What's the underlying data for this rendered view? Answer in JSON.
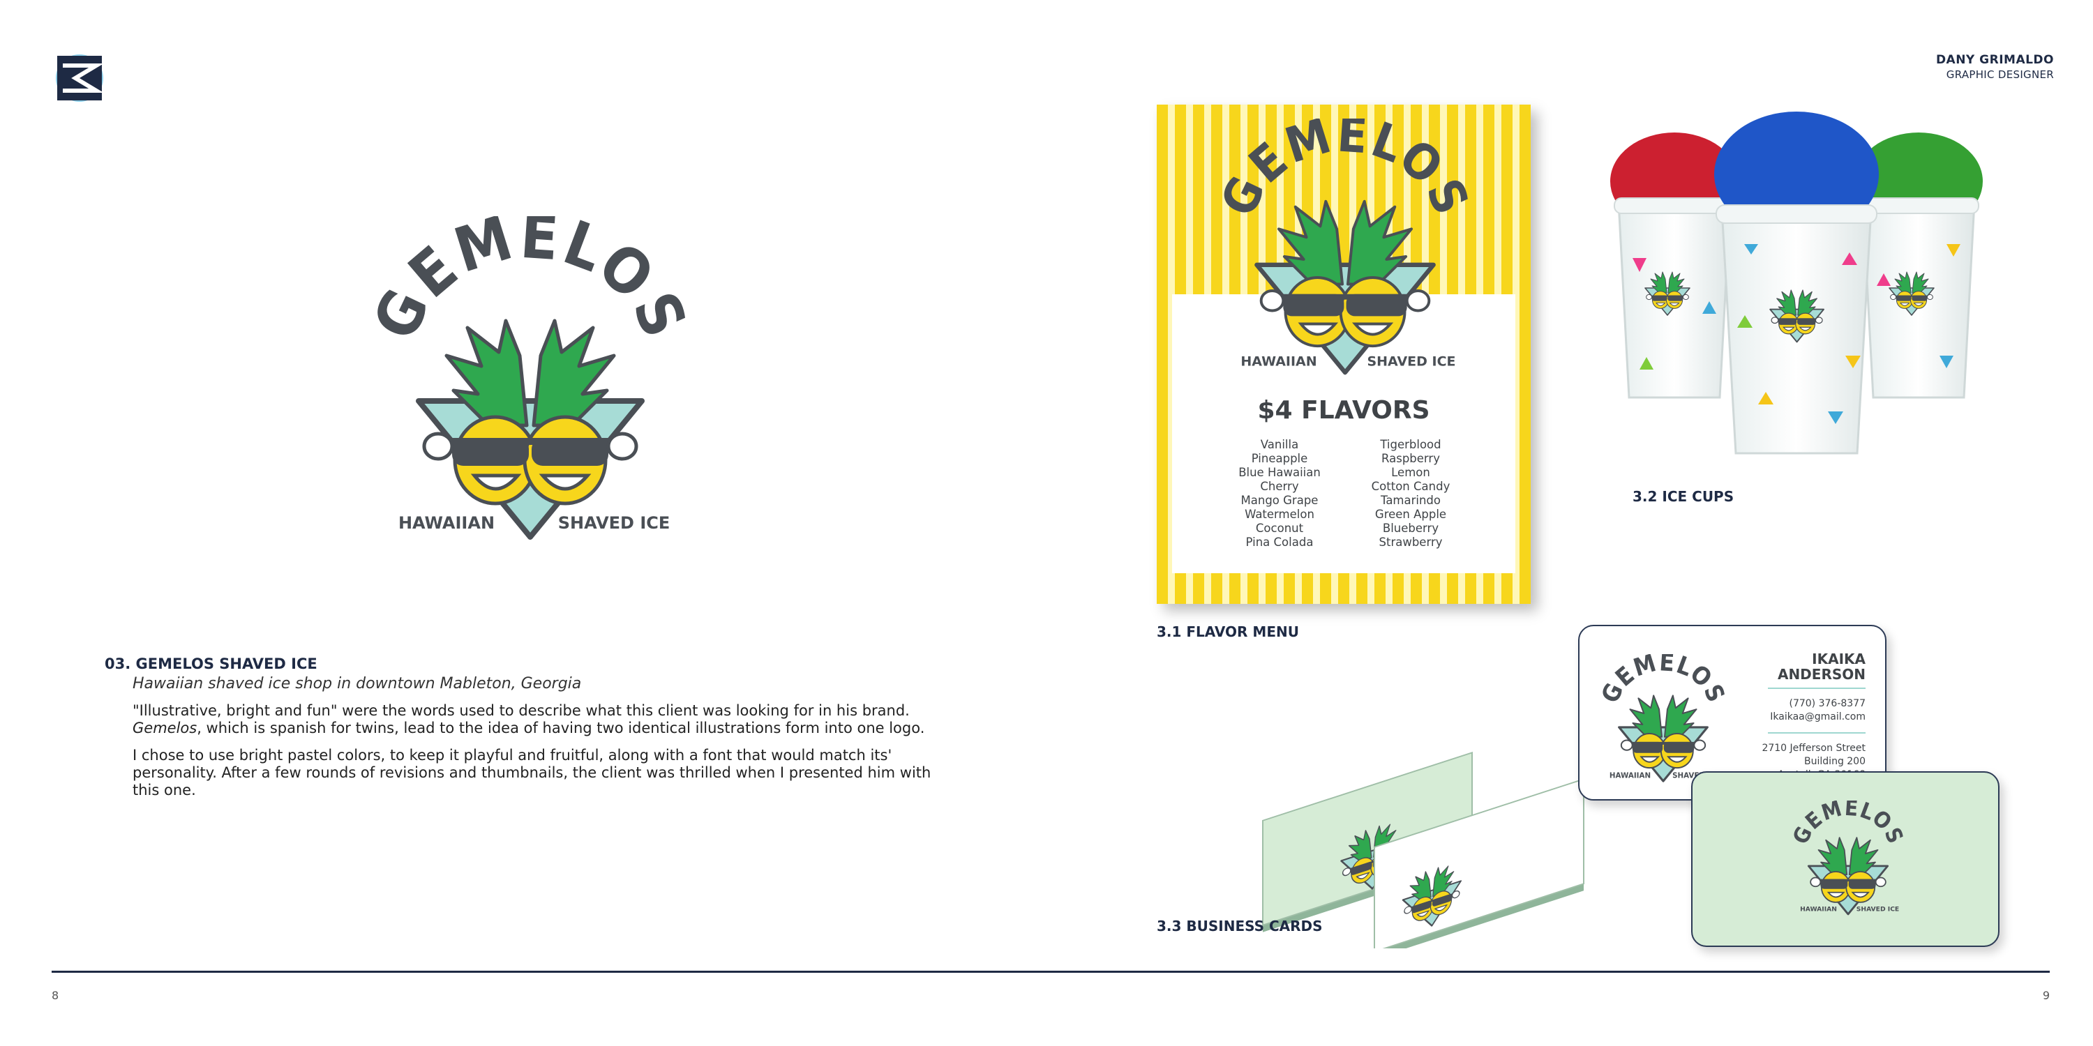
{
  "header": {
    "designer_name": "DANY GRIMALDO",
    "designer_role": "GRAPHIC DESIGNER"
  },
  "logo": {
    "brand": "GEMELOS",
    "left_tag": "HAWAIIAN",
    "right_tag": "SHAVED ICE"
  },
  "project": {
    "title": "03. GEMELOS SHAVED ICE",
    "subtitle": "Hawaiian shaved ice shop in downtown Mableton, Georgia",
    "paragraph1_a": "\"Illustrative, bright and fun\" were the words used to describe what this client was looking for in his brand.",
    "paragraph1_b_em": "Gemelos",
    "paragraph1_b": ", which is spanish for twins, lead to the idea of having two identical illustrations form into one logo.",
    "paragraph2": "I chose to use bright pastel colors, to keep it playful and fruitful, along with a font that would match its' personality. After a few rounds of revisions and thumbnails, the client was thrilled when I presented him with this one."
  },
  "menu": {
    "heading": "$4 FLAVORS",
    "flavors_left": [
      "Vanilla",
      "Pineapple",
      "Blue Hawaiian",
      "Cherry",
      "Mango Grape",
      "Watermelon",
      "Coconut",
      "Pina Colada"
    ],
    "flavors_right": [
      "Tigerblood",
      "Raspberry",
      "Lemon",
      "Cotton Candy",
      "Tamarindo",
      "Green Apple",
      "Blueberry",
      "Strawberry"
    ]
  },
  "captions": {
    "menu": "3.1  FLAVOR MENU",
    "cups": "3.2 ICE CUPS",
    "cards": "3.3 BUSINESS CARDS"
  },
  "business_card": {
    "first_name": "IKAIKA",
    "last_name": "ANDERSON",
    "phone": "(770) 376-8377",
    "email": "Ikaikaa@gmail.com",
    "street": "2710 Jefferson Street",
    "building": "Building 200",
    "city": "Austell, GA 30168"
  },
  "footer": {
    "page_left": "8",
    "page_right": "9"
  },
  "colors": {
    "navy": "#1e2a44",
    "yellow": "#f7d61c",
    "pineapple_green": "#2fa84f",
    "teal": "#a7dcd6",
    "mint": "#d6ecd6"
  }
}
